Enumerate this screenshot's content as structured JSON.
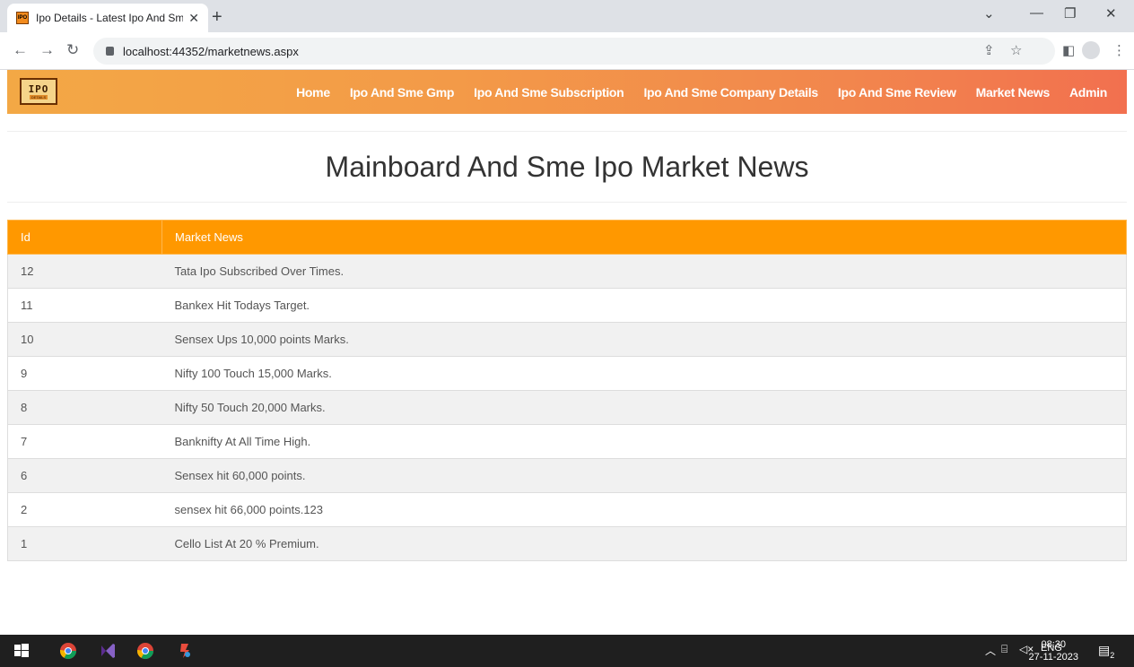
{
  "browser": {
    "tab_title": "Ipo Details - Latest Ipo And Sme",
    "tab_close": "✕",
    "new_tab": "+",
    "url": "localhost:44352/marketnews.aspx",
    "win_minimize": "—",
    "win_restore": "❐",
    "win_close": "✕",
    "tab_menu": "⌄"
  },
  "site": {
    "logo_top": "IPO",
    "logo_bottom": "DETAILS",
    "nav": [
      "Home",
      "Ipo And Sme Gmp",
      "Ipo And Sme Subscription",
      "Ipo And Sme Company Details",
      "Ipo And Sme Review",
      "Market News",
      "Admin"
    ]
  },
  "page": {
    "title": "Mainboard And Sme Ipo Market News"
  },
  "table": {
    "headers": [
      "Id",
      "Market News"
    ],
    "rows": [
      [
        "12",
        "Tata Ipo Subscribed Over Times."
      ],
      [
        "11",
        "Bankex Hit Todays Target."
      ],
      [
        "10",
        "Sensex Ups 10,000 points Marks."
      ],
      [
        "9",
        "Nifty 100 Touch 15,000 Marks."
      ],
      [
        "8",
        "Nifty 50 Touch 20,000 Marks."
      ],
      [
        "7",
        "Banknifty At All Time High."
      ],
      [
        "6",
        "Sensex hit 60,000 points."
      ],
      [
        "2",
        "sensex hit 66,000 points.123"
      ],
      [
        "1",
        "Cello List At 20 % Premium."
      ]
    ]
  },
  "taskbar": {
    "lang": "ENG",
    "time": "08:30",
    "date": "27-11-2023",
    "notifications": "2"
  }
}
